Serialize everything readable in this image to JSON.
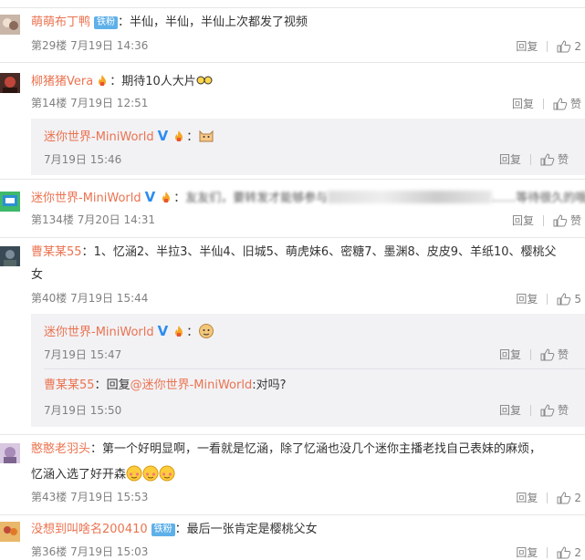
{
  "comments": [
    {
      "user": "萌萌布丁鸭",
      "badge": "铁粉",
      "colon": "：",
      "text": "半仙，半仙，半仙上次都发了视频",
      "meta": "第29楼 7月19日 14:36",
      "reply_label": "回复",
      "likes": "2"
    },
    {
      "user": "柳猪猪Vera",
      "colon": "：",
      "text": "期待10人大片",
      "meta": "第14楼 7月19日 12:51",
      "reply_label": "回复",
      "likes": "赞",
      "replies": [
        {
          "user": "迷你世界-MiniWorld",
          "colon": "：",
          "meta": "7月19日 15:46",
          "reply_label": "回复",
          "likes": "赞"
        }
      ]
    },
    {
      "user": "迷你世界-MiniWorld",
      "colon": "：",
      "text_start": "友友们，要转发才能够参与",
      "text_end": "……等待很久的哦",
      "meta": "第134楼 7月20日 14:31",
      "reply_label": "回复",
      "likes": "赞"
    },
    {
      "user": "曹某某55",
      "colon": "：",
      "text_line1": "1、忆涵2、半拉3、半仙4、旧城5、萌虎妹6、密糖7、墨渊8、皮皮9、羊纸10、樱桃父",
      "text_line2": "女",
      "meta": "第40楼 7月19日 15:44",
      "reply_label": "回复",
      "likes": "5",
      "replies": [
        {
          "user": "迷你世界-MiniWorld",
          "colon": "：",
          "meta": "7月19日 15:47",
          "reply_label": "回复",
          "likes": "赞"
        },
        {
          "user": "曹某某55",
          "colon": "：",
          "text_prefix": "回复",
          "mention": "@迷你世界-MiniWorld",
          "text_suffix": ":对吗?",
          "meta": "7月19日 15:50",
          "reply_label": "回复",
          "likes": "赞"
        }
      ]
    },
    {
      "user": "憨憨老羽头",
      "colon": "：",
      "text_line1": "第一个好明显啊，一看就是忆涵，除了忆涵也没几个迷你主播老找自己表妹的麻烦，",
      "text_line2": "忆涵入选了好开森",
      "meta": "第43楼 7月19日 15:53",
      "reply_label": "回复",
      "likes": "2"
    },
    {
      "user": "没想到叫啥名200410",
      "badge": "铁粉",
      "colon": "：",
      "text": "最后一张肯定是樱桃父女",
      "meta": "第36楼 7月19日 15:03",
      "reply_label": "回复",
      "likes": "2"
    }
  ]
}
